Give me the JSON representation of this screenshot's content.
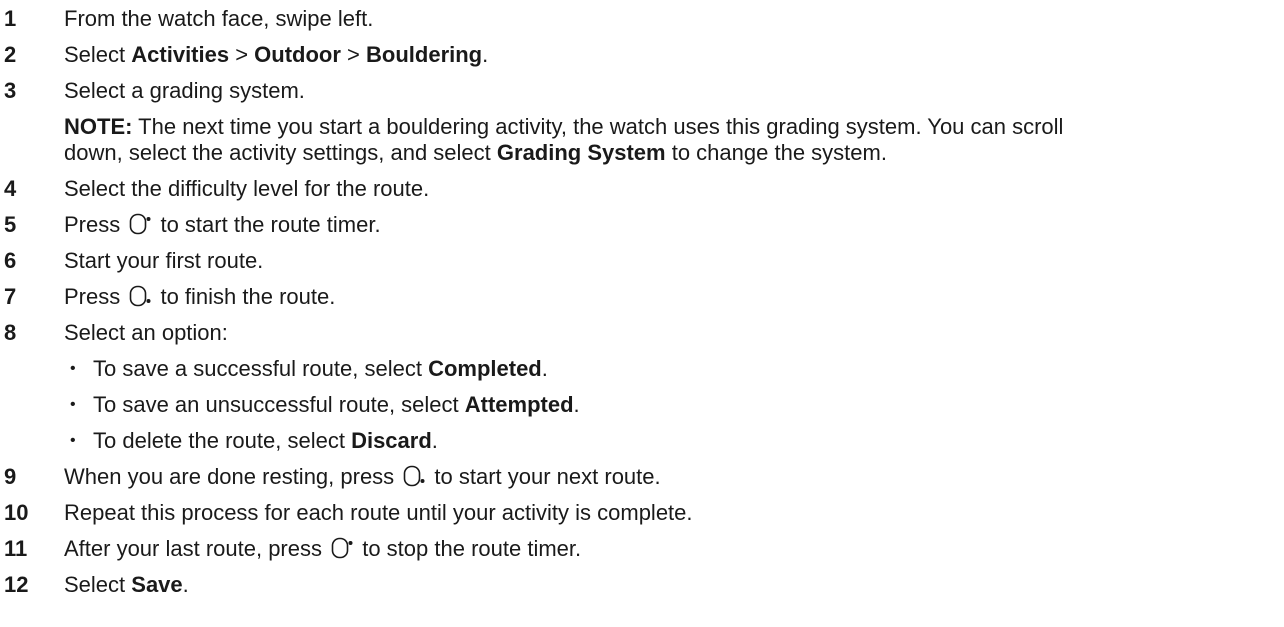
{
  "steps": [
    {
      "num": "1",
      "text": "From the watch face, swipe left."
    },
    {
      "num": "2",
      "pre": "Select ",
      "b1": "Activities",
      "s1": " > ",
      "b2": "Outdoor",
      "s2": " > ",
      "b3": "Bouldering",
      "post": "."
    },
    {
      "num": "3",
      "text": "Select a grading system."
    },
    {
      "num": "4",
      "text": "Select the difficulty level for the route."
    },
    {
      "num": "5",
      "pre": "Press ",
      "post": " to start the route timer.",
      "icon": "top-button-icon"
    },
    {
      "num": "6",
      "text": "Start your first route."
    },
    {
      "num": "7",
      "pre": "Press ",
      "post": " to finish the route.",
      "icon": "bottom-button-icon"
    },
    {
      "num": "8",
      "text": "Select an option:"
    },
    {
      "num": "9",
      "pre": "When you are done resting, press ",
      "post": " to start your next route.",
      "icon": "bottom-button-icon"
    },
    {
      "num": "10",
      "text": "Repeat this process for each route until your activity is complete."
    },
    {
      "num": "11",
      "pre": "After your last route, press ",
      "post": " to stop the route timer.",
      "icon": "top-button-icon"
    },
    {
      "num": "12",
      "pre": "Select ",
      "b1": "Save",
      "post": "."
    }
  ],
  "note": {
    "label": "NOTE:",
    "line1": " The next time you start a bouldering activity, the watch uses this grading system. You can scroll",
    "line2_pre": "down, select the activity settings, and select ",
    "line2_bold": "Grading System",
    "line2_post": " to change the system."
  },
  "options": [
    {
      "bullet": "•",
      "pre": "To save a successful route, select ",
      "bold": "Completed",
      "post": "."
    },
    {
      "bullet": "•",
      "pre": "To save an unsuccessful route, select ",
      "bold": "Attempted",
      "post": "."
    },
    {
      "bullet": "•",
      "pre": "To delete the route, select ",
      "bold": "Discard",
      "post": "."
    }
  ]
}
